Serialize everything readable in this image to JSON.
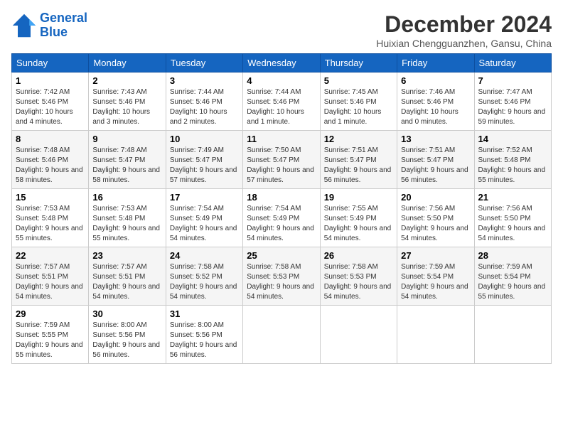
{
  "header": {
    "logo_line1": "General",
    "logo_line2": "Blue",
    "month": "December 2024",
    "location": "Huixian Chengguanzhen, Gansu, China"
  },
  "days_of_week": [
    "Sunday",
    "Monday",
    "Tuesday",
    "Wednesday",
    "Thursday",
    "Friday",
    "Saturday"
  ],
  "weeks": [
    [
      {
        "day": "1",
        "sunrise": "Sunrise: 7:42 AM",
        "sunset": "Sunset: 5:46 PM",
        "daylight": "Daylight: 10 hours and 4 minutes."
      },
      {
        "day": "2",
        "sunrise": "Sunrise: 7:43 AM",
        "sunset": "Sunset: 5:46 PM",
        "daylight": "Daylight: 10 hours and 3 minutes."
      },
      {
        "day": "3",
        "sunrise": "Sunrise: 7:44 AM",
        "sunset": "Sunset: 5:46 PM",
        "daylight": "Daylight: 10 hours and 2 minutes."
      },
      {
        "day": "4",
        "sunrise": "Sunrise: 7:44 AM",
        "sunset": "Sunset: 5:46 PM",
        "daylight": "Daylight: 10 hours and 1 minute."
      },
      {
        "day": "5",
        "sunrise": "Sunrise: 7:45 AM",
        "sunset": "Sunset: 5:46 PM",
        "daylight": "Daylight: 10 hours and 1 minute."
      },
      {
        "day": "6",
        "sunrise": "Sunrise: 7:46 AM",
        "sunset": "Sunset: 5:46 PM",
        "daylight": "Daylight: 10 hours and 0 minutes."
      },
      {
        "day": "7",
        "sunrise": "Sunrise: 7:47 AM",
        "sunset": "Sunset: 5:46 PM",
        "daylight": "Daylight: 9 hours and 59 minutes."
      }
    ],
    [
      {
        "day": "8",
        "sunrise": "Sunrise: 7:48 AM",
        "sunset": "Sunset: 5:46 PM",
        "daylight": "Daylight: 9 hours and 58 minutes."
      },
      {
        "day": "9",
        "sunrise": "Sunrise: 7:48 AM",
        "sunset": "Sunset: 5:47 PM",
        "daylight": "Daylight: 9 hours and 58 minutes."
      },
      {
        "day": "10",
        "sunrise": "Sunrise: 7:49 AM",
        "sunset": "Sunset: 5:47 PM",
        "daylight": "Daylight: 9 hours and 57 minutes."
      },
      {
        "day": "11",
        "sunrise": "Sunrise: 7:50 AM",
        "sunset": "Sunset: 5:47 PM",
        "daylight": "Daylight: 9 hours and 57 minutes."
      },
      {
        "day": "12",
        "sunrise": "Sunrise: 7:51 AM",
        "sunset": "Sunset: 5:47 PM",
        "daylight": "Daylight: 9 hours and 56 minutes."
      },
      {
        "day": "13",
        "sunrise": "Sunrise: 7:51 AM",
        "sunset": "Sunset: 5:47 PM",
        "daylight": "Daylight: 9 hours and 56 minutes."
      },
      {
        "day": "14",
        "sunrise": "Sunrise: 7:52 AM",
        "sunset": "Sunset: 5:48 PM",
        "daylight": "Daylight: 9 hours and 55 minutes."
      }
    ],
    [
      {
        "day": "15",
        "sunrise": "Sunrise: 7:53 AM",
        "sunset": "Sunset: 5:48 PM",
        "daylight": "Daylight: 9 hours and 55 minutes."
      },
      {
        "day": "16",
        "sunrise": "Sunrise: 7:53 AM",
        "sunset": "Sunset: 5:48 PM",
        "daylight": "Daylight: 9 hours and 55 minutes."
      },
      {
        "day": "17",
        "sunrise": "Sunrise: 7:54 AM",
        "sunset": "Sunset: 5:49 PM",
        "daylight": "Daylight: 9 hours and 54 minutes."
      },
      {
        "day": "18",
        "sunrise": "Sunrise: 7:54 AM",
        "sunset": "Sunset: 5:49 PM",
        "daylight": "Daylight: 9 hours and 54 minutes."
      },
      {
        "day": "19",
        "sunrise": "Sunrise: 7:55 AM",
        "sunset": "Sunset: 5:49 PM",
        "daylight": "Daylight: 9 hours and 54 minutes."
      },
      {
        "day": "20",
        "sunrise": "Sunrise: 7:56 AM",
        "sunset": "Sunset: 5:50 PM",
        "daylight": "Daylight: 9 hours and 54 minutes."
      },
      {
        "day": "21",
        "sunrise": "Sunrise: 7:56 AM",
        "sunset": "Sunset: 5:50 PM",
        "daylight": "Daylight: 9 hours and 54 minutes."
      }
    ],
    [
      {
        "day": "22",
        "sunrise": "Sunrise: 7:57 AM",
        "sunset": "Sunset: 5:51 PM",
        "daylight": "Daylight: 9 hours and 54 minutes."
      },
      {
        "day": "23",
        "sunrise": "Sunrise: 7:57 AM",
        "sunset": "Sunset: 5:51 PM",
        "daylight": "Daylight: 9 hours and 54 minutes."
      },
      {
        "day": "24",
        "sunrise": "Sunrise: 7:58 AM",
        "sunset": "Sunset: 5:52 PM",
        "daylight": "Daylight: 9 hours and 54 minutes."
      },
      {
        "day": "25",
        "sunrise": "Sunrise: 7:58 AM",
        "sunset": "Sunset: 5:53 PM",
        "daylight": "Daylight: 9 hours and 54 minutes."
      },
      {
        "day": "26",
        "sunrise": "Sunrise: 7:58 AM",
        "sunset": "Sunset: 5:53 PM",
        "daylight": "Daylight: 9 hours and 54 minutes."
      },
      {
        "day": "27",
        "sunrise": "Sunrise: 7:59 AM",
        "sunset": "Sunset: 5:54 PM",
        "daylight": "Daylight: 9 hours and 54 minutes."
      },
      {
        "day": "28",
        "sunrise": "Sunrise: 7:59 AM",
        "sunset": "Sunset: 5:54 PM",
        "daylight": "Daylight: 9 hours and 55 minutes."
      }
    ],
    [
      {
        "day": "29",
        "sunrise": "Sunrise: 7:59 AM",
        "sunset": "Sunset: 5:55 PM",
        "daylight": "Daylight: 9 hours and 55 minutes."
      },
      {
        "day": "30",
        "sunrise": "Sunrise: 8:00 AM",
        "sunset": "Sunset: 5:56 PM",
        "daylight": "Daylight: 9 hours and 56 minutes."
      },
      {
        "day": "31",
        "sunrise": "Sunrise: 8:00 AM",
        "sunset": "Sunset: 5:56 PM",
        "daylight": "Daylight: 9 hours and 56 minutes."
      },
      null,
      null,
      null,
      null
    ]
  ]
}
